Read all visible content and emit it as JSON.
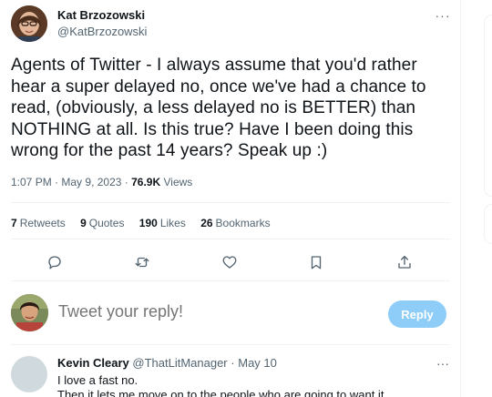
{
  "tweet": {
    "author_name": "Kat Brzozowski",
    "author_handle": "@KatBrzozowski",
    "more_label": "···",
    "text": "Agents of Twitter - I always assume that you'd rather hear a super delayed no, once we've had a chance to read, (obviously, a less delayed no is BETTER) than NOTHING at all. Is this true? Have I been doing this wrong for the past 14 years? Speak up :)",
    "time": "1:07 PM",
    "date": "May 9, 2023",
    "separator": "·",
    "views_count": "76.9K",
    "views_label": "Views"
  },
  "stats": [
    {
      "num": "7",
      "label": "Retweets"
    },
    {
      "num": "9",
      "label": "Quotes"
    },
    {
      "num": "190",
      "label": "Likes"
    },
    {
      "num": "26",
      "label": "Bookmarks"
    }
  ],
  "actions": [
    {
      "name": "reply-icon"
    },
    {
      "name": "retweet-icon"
    },
    {
      "name": "like-icon"
    },
    {
      "name": "bookmark-icon"
    },
    {
      "name": "share-icon"
    }
  ],
  "reply_box": {
    "placeholder": "Tweet your reply!",
    "button_label": "Reply",
    "button_color": "#8ecdf8"
  },
  "replies": [
    {
      "name": "Kevin Cleary",
      "handle": "@ThatLitManager",
      "separator": "·",
      "date": "May 10",
      "line1": "I love a fast no.",
      "line2": "Then it lets me move on to the people who are going to want it.",
      "more_label": "···"
    }
  ],
  "colors": {
    "text_primary": "#0f1419",
    "text_secondary": "#536471",
    "divider": "#eff3f4",
    "accent": "#1d9bf0"
  }
}
